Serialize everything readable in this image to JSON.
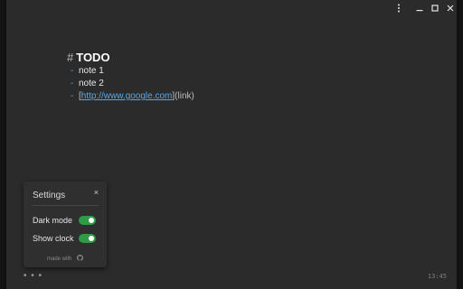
{
  "window": {
    "controls": [
      "menu-dots-icon",
      "minimize-icon",
      "maximize-icon",
      "close-icon"
    ]
  },
  "editor": {
    "heading_marker": "#",
    "heading": "TODO",
    "lines": [
      {
        "dash": "-",
        "text": "note 1"
      },
      {
        "dash": "-",
        "text": "note 2"
      }
    ],
    "link_line": {
      "dash": "-",
      "open_bracket": "[",
      "url": "http://www.google.com",
      "close_bracket": "]",
      "suffix": "(link)"
    }
  },
  "settings": {
    "title": "Settings",
    "close_glyph": "×",
    "dark_mode_label": "Dark mode",
    "dark_mode_on": true,
    "show_clock_label": "Show clock",
    "show_clock_on": true,
    "made_with": "made with"
  },
  "footer": {
    "menu_dots": "• • •",
    "clock": "13:45"
  },
  "colors": {
    "background": "#2b2b2b",
    "toggle_on": "#2e9c45",
    "link": "#5aa9e6"
  }
}
